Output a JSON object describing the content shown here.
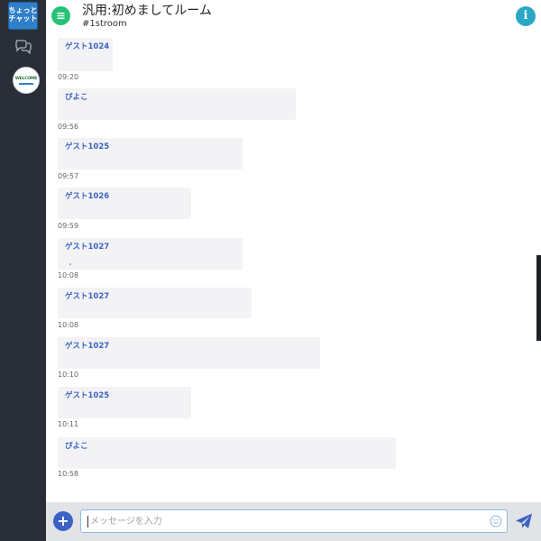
{
  "app": {
    "logo_text": [
      "ちょっと",
      "チャット"
    ],
    "avatar_text": "WELCOME"
  },
  "header": {
    "room_title": "汎用:初めましてルーム",
    "channel": "#1stroom",
    "info_icon": "i"
  },
  "messages": [
    {
      "author": "ゲスト1024",
      "time": "09:20"
    },
    {
      "author": "ぴよこ",
      "time": "09:56"
    },
    {
      "author": "ゲスト1025",
      "time": "09:57"
    },
    {
      "author": "ゲスト1026",
      "time": "09:59"
    },
    {
      "author": "ゲスト1027",
      "time": "10:08"
    },
    {
      "author": "ゲスト1027",
      "time": "10:08"
    },
    {
      "author": "ゲスト1027",
      "time": "10:10"
    },
    {
      "author": "ゲスト1025",
      "time": "10:11"
    },
    {
      "author": "ぴよこ",
      "time": "10:58"
    }
  ],
  "composer": {
    "placeholder": "メッセージを入力",
    "value": "",
    "plus_label": "+"
  },
  "colors": {
    "sidebar": "#2a2f37",
    "menu_button": "#27c27a",
    "info_button": "#2aa8c5",
    "author": "#3b63c4",
    "bubble": "#f3f3f5",
    "composer_bar": "#e1e3e6",
    "send": "#3b63c4"
  },
  "icons": {
    "menu": "hamburger-icon",
    "chat": "chat-bubbles-icon",
    "info": "info-icon",
    "add": "plus-icon",
    "emoji": "smiley-icon",
    "send": "paper-plane-icon"
  }
}
